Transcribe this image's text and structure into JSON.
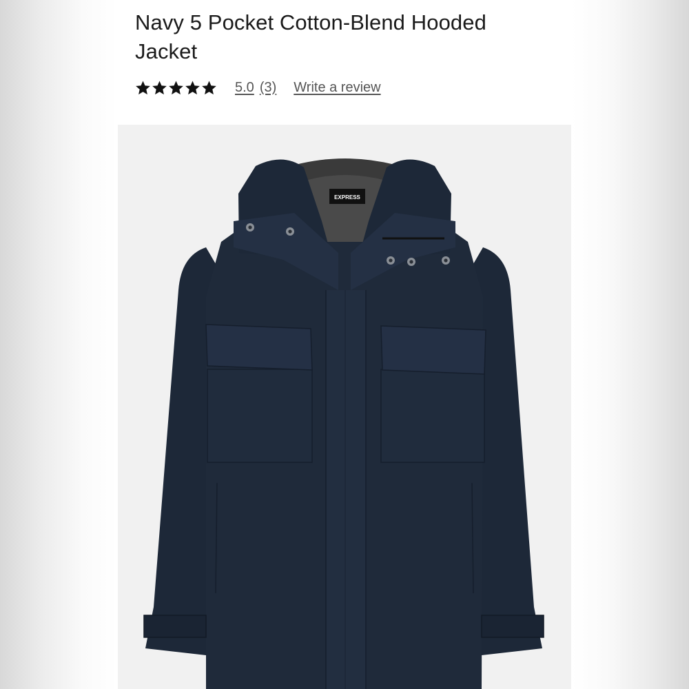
{
  "product": {
    "title": "Navy 5 Pocket Cotton-Blend Hooded Jacket",
    "rating": {
      "stars": 5,
      "max_stars": 5,
      "value_label": "5.0",
      "count_label": "(3)",
      "write_review_label": "Write a review"
    },
    "image": {
      "brand_tag": "EXPRESS",
      "jacket_color": "#1d2838",
      "background_color": "#f1f1f1"
    }
  },
  "colors": {
    "text": "#1a1a1a",
    "link": "#555555",
    "star": "#111111"
  }
}
